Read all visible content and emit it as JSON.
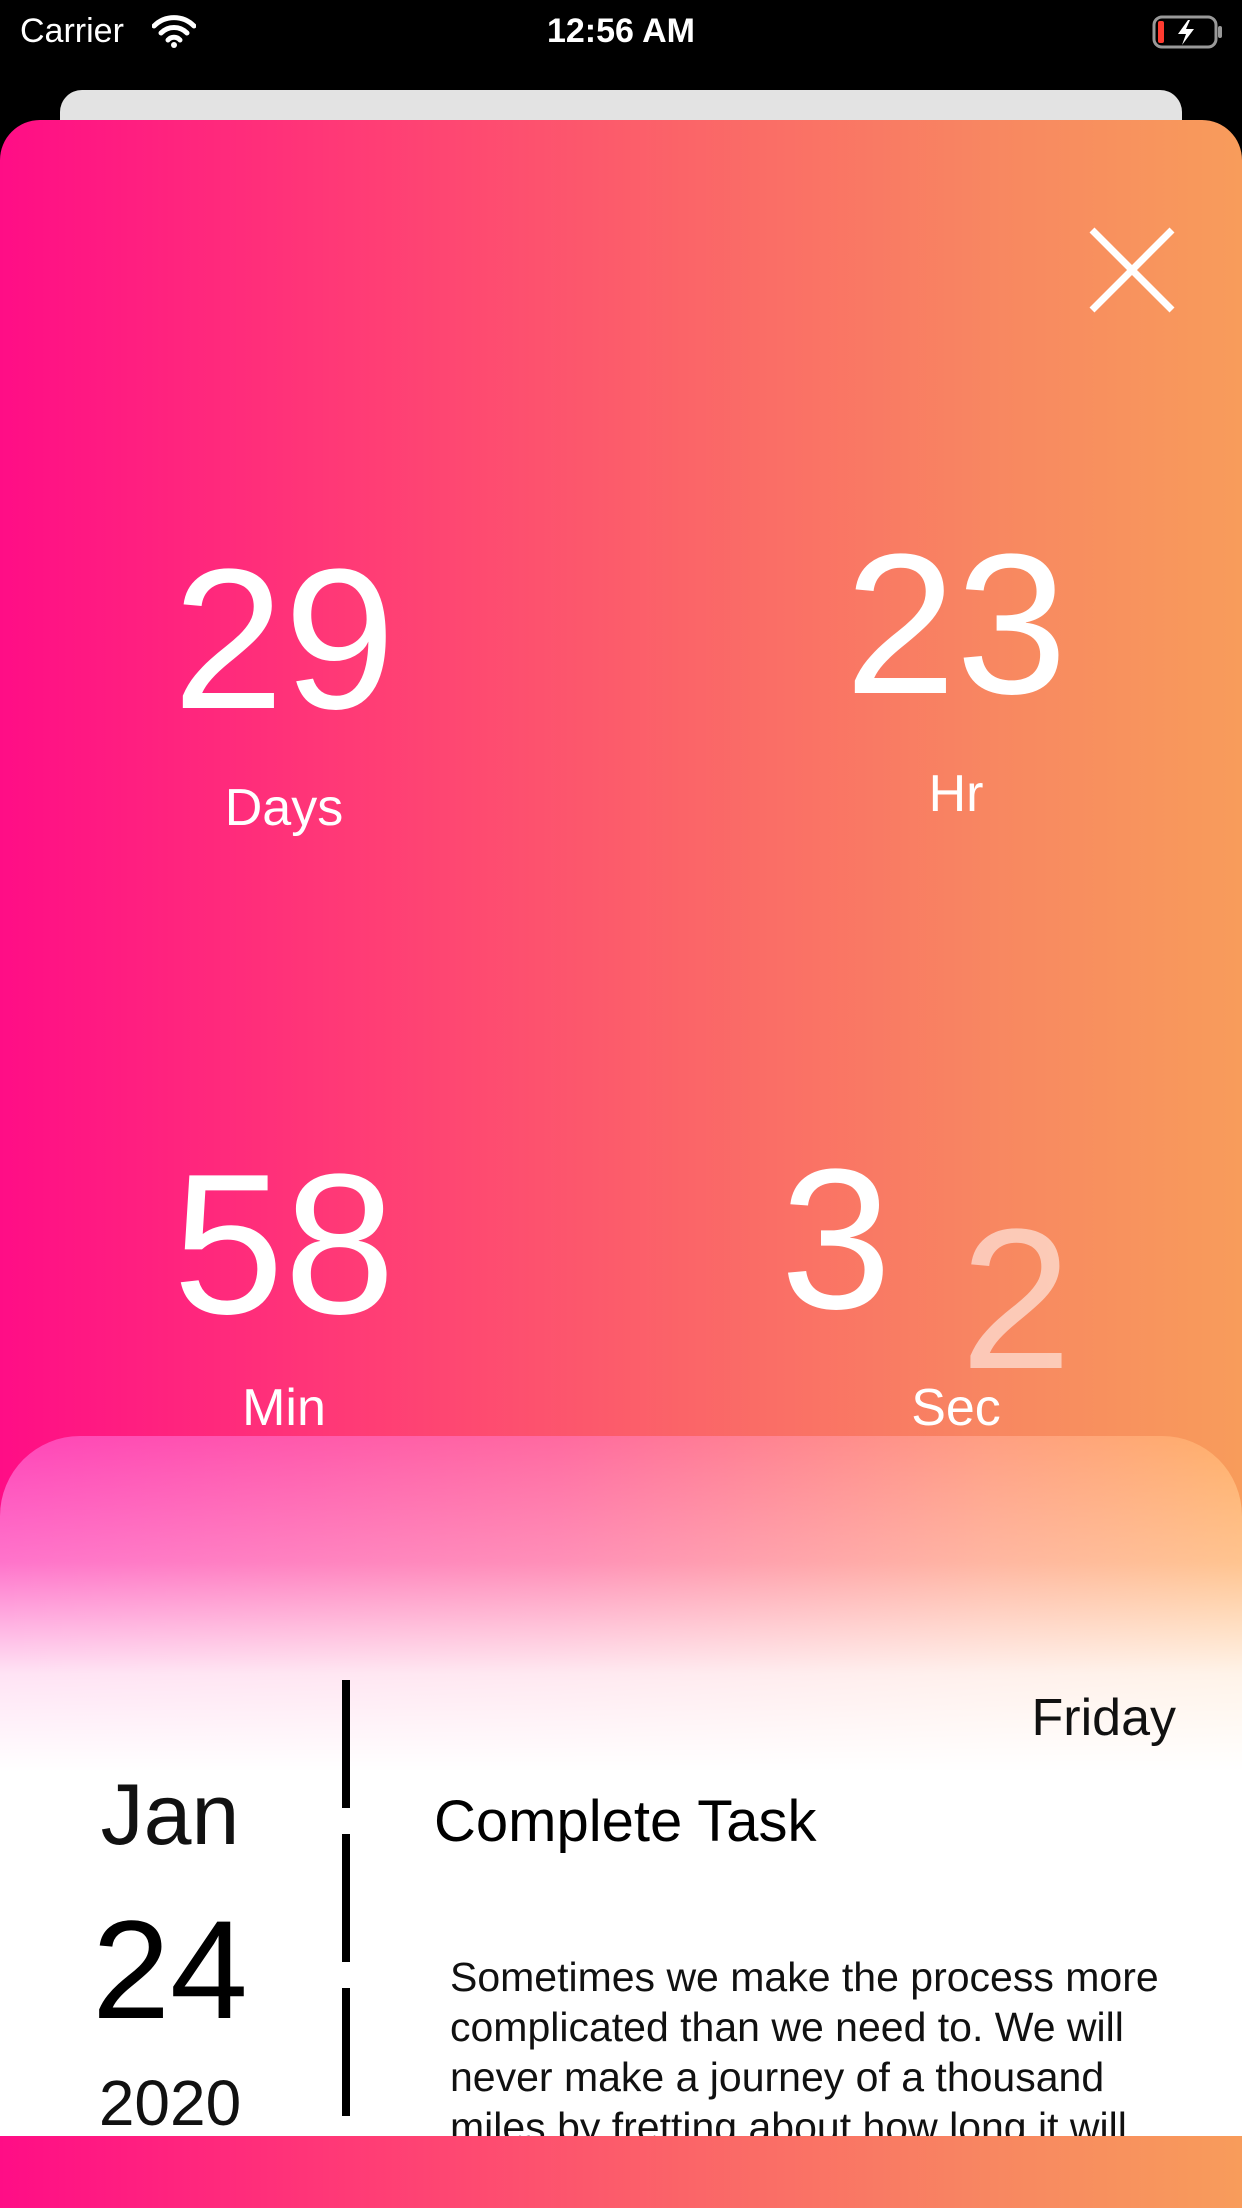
{
  "status_bar": {
    "carrier": "Carrier",
    "time": "12:56 AM"
  },
  "countdown": {
    "days": {
      "value": "29",
      "label": "Days"
    },
    "hours": {
      "value": "23",
      "label": "Hr"
    },
    "minutes": {
      "value": "58",
      "label": "Min"
    },
    "seconds": {
      "value": "3",
      "next_value": "2",
      "label": "Sec"
    }
  },
  "event": {
    "month": "Jan",
    "day": "24",
    "year": "2020",
    "weekday": "Friday",
    "title": "Complete Task",
    "description": "Sometimes we make the process more complicated than we need to. We will never make a journey of a thousand miles by fretting about how long it will take or how hard it"
  },
  "colors": {
    "gradient_start": "#ff0d86",
    "gradient_end": "#f89c5b",
    "card_pink": "#ff45b9",
    "card_orange": "#ffb06a"
  },
  "icons": [
    "wifi-icon",
    "battery-charging-icon",
    "close-icon"
  ]
}
